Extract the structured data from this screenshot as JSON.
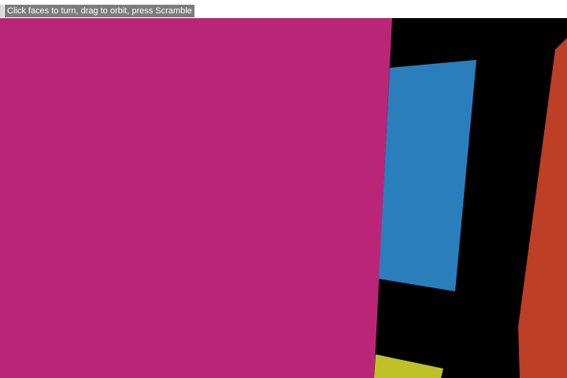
{
  "hud": {
    "hint": "Click faces to turn, drag to orbit, press Scramble"
  },
  "colors": {
    "background": "#000000",
    "magenta": "#bb2578",
    "blue": "#2a7ebc",
    "orange": "#bc3f26",
    "yellow": "#c0c126"
  },
  "icons": {
    "scramble": "scramble-button"
  }
}
